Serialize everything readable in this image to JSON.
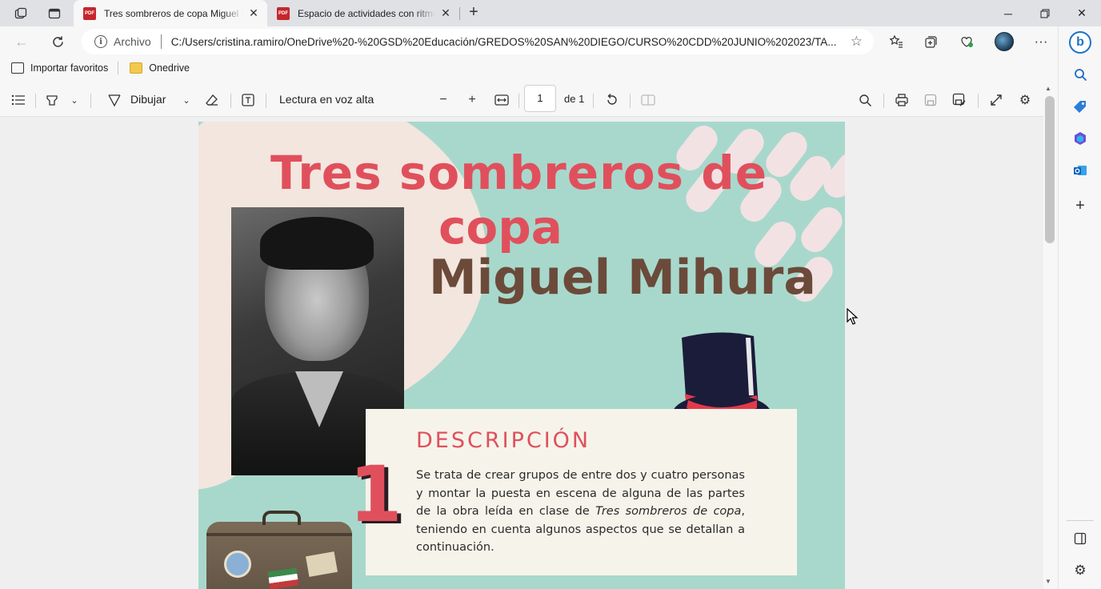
{
  "tabs": [
    {
      "title": "Tres sombreros de copa Miguel Mihura",
      "active": true,
      "icon": "pdf-icon"
    },
    {
      "title": "Espacio de actividades con ritmo",
      "active": false,
      "icon": "pdf-icon"
    }
  ],
  "address": {
    "scheme_label": "Archivo",
    "url": "C:/Users/cristina.ramiro/OneDrive%20-%20GSD%20Educación/GREDOS%20SAN%20DIEGO/CURSO%20CDD%20JUNIO%202023/TA..."
  },
  "favorites": [
    {
      "label": "Importar favoritos",
      "icon": "import-icon"
    },
    {
      "label": "Onedrive",
      "icon": "folder-icon"
    }
  ],
  "pdf_toolbar": {
    "draw_label": "Dibujar",
    "read_aloud_label": "Lectura en voz alta",
    "page_current": "1",
    "page_total_label": "de 1"
  },
  "document": {
    "title_line1": "Tres sombreros de",
    "title_line2": "copa",
    "author": "Miguel Mihura",
    "section_number": "1",
    "section_heading": "DESCRIPCIÓN",
    "description_part1": "Se trata de crear grupos de entre dos y cuatro personas y montar la puesta en escena de alguna de las partes de la obra leída en clase de ",
    "description_italic": "Tres sombreros de copa",
    "description_part2": ", teniendo en cuenta algunos aspectos que se detallan a continuación."
  },
  "colors": {
    "accent_red": "#e0505c",
    "author_brown": "#6b4a3a",
    "page_teal": "#a8d8cc",
    "page_cream": "#f2e6de",
    "box_cream": "#f6f4ea"
  }
}
